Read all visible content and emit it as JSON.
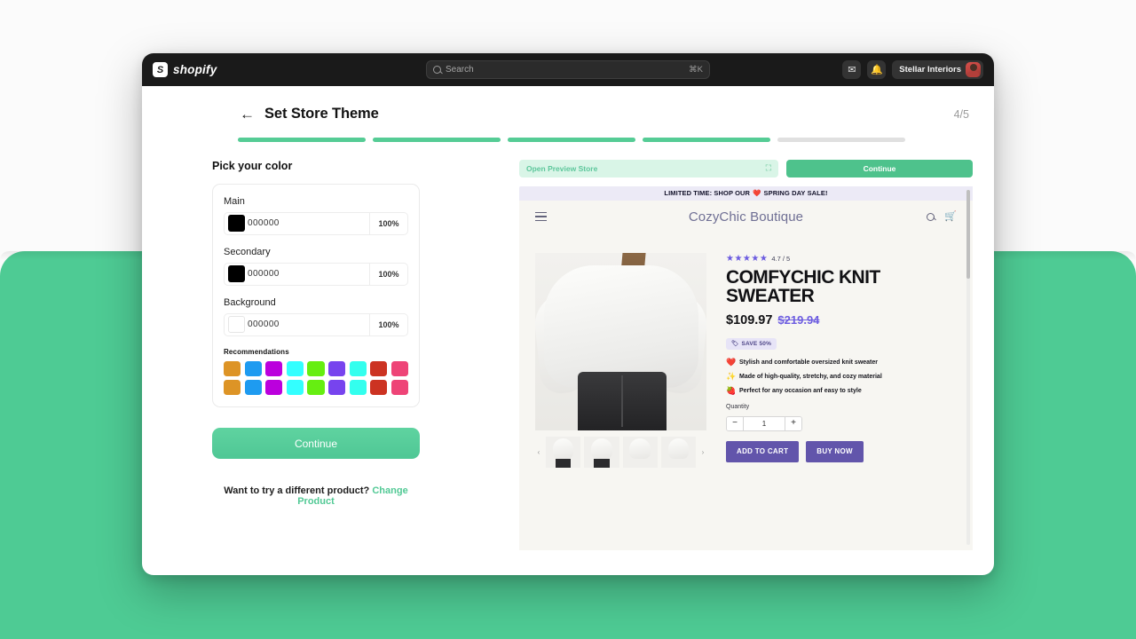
{
  "topbar": {
    "brand": "shopify",
    "brand_glyph": "S",
    "search_placeholder": "Search",
    "search_shortcut": "⌘K",
    "inbox_icon": "inbox-icon",
    "bell_icon": "bell-icon",
    "account_name": "Stellar Interiors"
  },
  "header": {
    "back_arrow": "←",
    "title": "Set Store Theme",
    "step_counter": "4/5",
    "progress_total": 5,
    "progress_done": 4
  },
  "left": {
    "section_title": "Pick your color",
    "fields": [
      {
        "label": "Main",
        "hex": "000000",
        "opacity": "100%",
        "swatch": "#000000",
        "empty": false
      },
      {
        "label": "Secondary",
        "hex": "000000",
        "opacity": "100%",
        "swatch": "#000000",
        "empty": false
      },
      {
        "label": "Background",
        "hex": "000000",
        "opacity": "100%",
        "swatch": "#ffffff",
        "empty": true
      }
    ],
    "recommendations_label": "Recommendations",
    "recommendations": [
      "#dd9426",
      "#1e9bf0",
      "#bb00dd",
      "#33ffff",
      "#66ee11",
      "#7744ee",
      "#33ffee",
      "#cc3322",
      "#ee4477",
      "#dd9426",
      "#1e9bf0",
      "#bb00dd",
      "#33ffff",
      "#66ee11",
      "#7744ee",
      "#33ffee",
      "#cc3322",
      "#ee4477"
    ],
    "continue_label": "Continue",
    "change_prompt": "Want to try a different product?",
    "change_link": "Change Product"
  },
  "preview": {
    "open_preview_label": "Open Preview Store",
    "expand_icon": "expand-icon",
    "continue_label": "Continue",
    "promo_text_before": "LIMITED TIME: SHOP OUR",
    "promo_emoji": "❤️",
    "promo_text_after": "SPRING DAY SALE!",
    "store_name": "CozyChic Boutique",
    "menu_icon": "hamburger-icon",
    "search_icon": "search-icon",
    "cart_icon": "cart-icon",
    "gallery": {
      "prev_arrow": "‹",
      "next_arrow": "›",
      "thumb_count": 4
    },
    "product": {
      "stars": "★★★★★",
      "rating_text": "4.7 / 5",
      "title": "ComfyChic Knit Sweater",
      "price_now": "$109.97",
      "price_old": "$219.94",
      "save_badge": "SAVE 50%",
      "save_icon": "tag-icon",
      "bullets": [
        {
          "icon": "❤️",
          "text": "Stylish and comfortable oversized knit sweater"
        },
        {
          "icon": "✨",
          "text": "Made of high-quality, stretchy, and cozy material"
        },
        {
          "icon": "🍓",
          "text": "Perfect for any occasion anf easy to style"
        }
      ],
      "quantity_label": "Quantity",
      "quantity_value": "1",
      "qty_minus": "−",
      "qty_plus": "+",
      "add_to_cart": "ADD TO CART",
      "buy_now": "BUY NOW"
    }
  },
  "colors": {
    "accent_green": "#55cc95",
    "brand_purple": "#6255ab",
    "backdrop_green": "#4ecb94",
    "topbar_dark": "#1a1a1a"
  }
}
